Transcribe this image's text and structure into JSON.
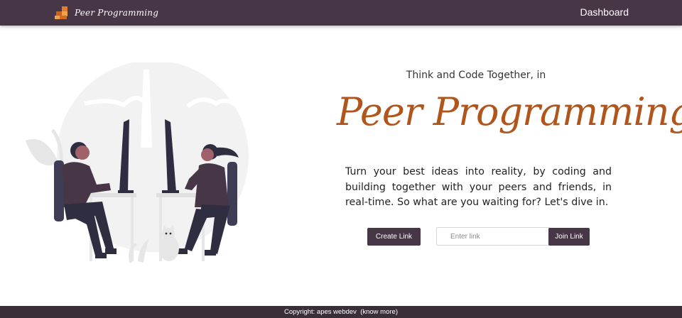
{
  "navbar": {
    "brand_name": "Peer Programming",
    "logo_icon": "stacked-boxes-logo-icon",
    "dashboard_link": "Dashboard"
  },
  "hero": {
    "tagline": "Think and Code Together, in",
    "title": "Peer Programming",
    "description": "Turn your best ideas into reality, by coding and building together with your peers and friends, in real-time. So what are you waiting for? Let's dive in.",
    "illustration": "two-people-coding-illustration"
  },
  "actions": {
    "create_label": "Create Link",
    "join_label": "Join Link",
    "link_placeholder": "Enter link",
    "link_value": ""
  },
  "footer": {
    "copyright": "Copyright: apes webdev",
    "know_more": "(know more)"
  },
  "colors": {
    "navbar": "#473646",
    "accent_title": "#b0561c",
    "button": "#473646",
    "footer": "#3a2e39"
  }
}
